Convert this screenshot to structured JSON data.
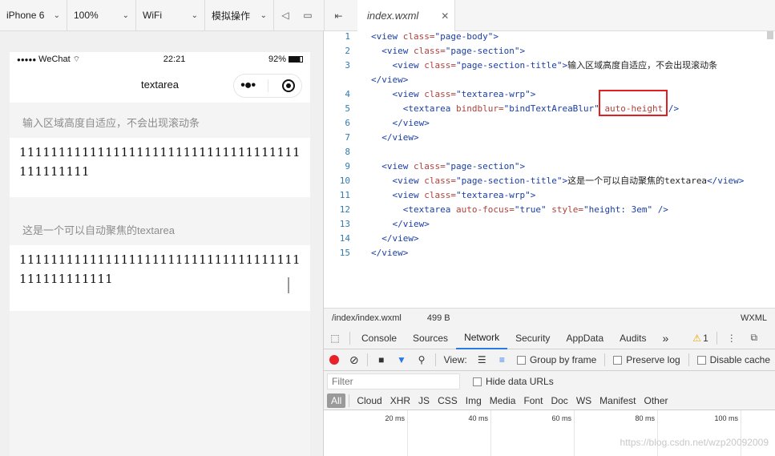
{
  "toolbar": {
    "device": "iPhone 6",
    "zoom": "100%",
    "network": "WiFi",
    "operation": "模拟操作",
    "mute_icon": "speaker-icon",
    "detach_icon": "window-icon",
    "sidebar_icon": "sidebar-toggle-icon"
  },
  "editor_tab": {
    "name": "index.wxml",
    "close": "✕"
  },
  "phone": {
    "status": {
      "signal": "●●●●●",
      "carrier": "WeChat",
      "time": "22:21",
      "battery": "92%"
    },
    "nav_title": "textarea",
    "sections": [
      {
        "title": "输入区域高度自适应，不会出现滚动条",
        "value": "111111111111111111111111111111111111111111111"
      },
      {
        "title": "这是一个可以自动聚焦的textarea",
        "value": "111111111111111111111111111111111111111111111111"
      }
    ]
  },
  "code": {
    "lines": [
      {
        "n": "1",
        "tokens": [
          [
            "t",
            "<view "
          ],
          [
            "a",
            "class="
          ],
          [
            "s",
            "\"page-body\""
          ],
          [
            "t",
            ">"
          ]
        ]
      },
      {
        "n": "2",
        "tokens": [
          [
            "x",
            "  "
          ],
          [
            "t",
            "<view "
          ],
          [
            "a",
            "class="
          ],
          [
            "s",
            "\"page-section\""
          ],
          [
            "t",
            ">"
          ]
        ]
      },
      {
        "n": "3",
        "tokens": [
          [
            "x",
            "    "
          ],
          [
            "t",
            "<view "
          ],
          [
            "a",
            "class="
          ],
          [
            "s",
            "\"page-section-title\""
          ],
          [
            "t",
            ">"
          ],
          [
            "x",
            "输入区域高度自适应，不会出现滚动条"
          ]
        ]
      },
      {
        "n": "",
        "tokens": [
          [
            "t",
            "</view>"
          ]
        ]
      },
      {
        "n": "4",
        "tokens": [
          [
            "x",
            "    "
          ],
          [
            "t",
            "<view "
          ],
          [
            "a",
            "class="
          ],
          [
            "s",
            "\"textarea-wrp\""
          ],
          [
            "t",
            ">"
          ]
        ]
      },
      {
        "n": "5",
        "tokens": [
          [
            "x",
            "      "
          ],
          [
            "t",
            "<textarea "
          ],
          [
            "a",
            "bindblur="
          ],
          [
            "s",
            "\"bindTextAreaBlur\""
          ],
          [
            "x",
            " "
          ],
          [
            "a",
            "auto-height"
          ],
          [
            "x",
            " "
          ],
          [
            "t",
            "/>"
          ]
        ]
      },
      {
        "n": "6",
        "tokens": [
          [
            "x",
            "    "
          ],
          [
            "t",
            "</view>"
          ]
        ]
      },
      {
        "n": "7",
        "tokens": [
          [
            "x",
            "  "
          ],
          [
            "t",
            "</view>"
          ]
        ]
      },
      {
        "n": "8",
        "tokens": []
      },
      {
        "n": "9",
        "tokens": [
          [
            "x",
            "  "
          ],
          [
            "t",
            "<view "
          ],
          [
            "a",
            "class="
          ],
          [
            "s",
            "\"page-section\""
          ],
          [
            "t",
            ">"
          ]
        ]
      },
      {
        "n": "10",
        "tokens": [
          [
            "x",
            "    "
          ],
          [
            "t",
            "<view "
          ],
          [
            "a",
            "class="
          ],
          [
            "s",
            "\"page-section-title\""
          ],
          [
            "t",
            ">"
          ],
          [
            "x",
            "这是一个可以自动聚焦的textarea"
          ],
          [
            "t",
            "</view>"
          ]
        ]
      },
      {
        "n": "11",
        "tokens": [
          [
            "x",
            "    "
          ],
          [
            "t",
            "<view "
          ],
          [
            "a",
            "class="
          ],
          [
            "s",
            "\"textarea-wrp\""
          ],
          [
            "t",
            ">"
          ]
        ]
      },
      {
        "n": "12",
        "tokens": [
          [
            "x",
            "      "
          ],
          [
            "t",
            "<textarea "
          ],
          [
            "a",
            "auto-focus="
          ],
          [
            "s",
            "\"true\""
          ],
          [
            "x",
            " "
          ],
          [
            "a",
            "style="
          ],
          [
            "s",
            "\"height: 3em\""
          ],
          [
            "x",
            " "
          ],
          [
            "t",
            "/>"
          ]
        ]
      },
      {
        "n": "13",
        "tokens": [
          [
            "x",
            "    "
          ],
          [
            "t",
            "</view>"
          ]
        ]
      },
      {
        "n": "14",
        "tokens": [
          [
            "x",
            "  "
          ],
          [
            "t",
            "</view>"
          ]
        ]
      },
      {
        "n": "15",
        "tokens": [
          [
            "t",
            "</view>"
          ]
        ]
      }
    ]
  },
  "file_status": {
    "path": "/index/index.wxml",
    "size": "499 B",
    "lang": "WXML"
  },
  "devtools": {
    "tabs": [
      "Console",
      "Sources",
      "Network",
      "Security",
      "AppData",
      "Audits"
    ],
    "active_tab": "Network",
    "more": "»",
    "warnings": "1",
    "network": {
      "view_label": "View:",
      "group_by_frame": "Group by frame",
      "preserve_log": "Preserve log",
      "disable_cache": "Disable cache",
      "filter_placeholder": "Filter",
      "hide_data_urls": "Hide data URLs",
      "types": [
        "All",
        "Cloud",
        "XHR",
        "JS",
        "CSS",
        "Img",
        "Media",
        "Font",
        "Doc",
        "WS",
        "Manifest",
        "Other"
      ],
      "ticks": [
        "20 ms",
        "40 ms",
        "60 ms",
        "80 ms",
        "100 ms"
      ]
    }
  },
  "watermark": "https://blog.csdn.net/wzp20092009",
  "colors": {
    "accent": "#2a7ae4",
    "record": "#e8202a",
    "highlight": "#e02020"
  }
}
